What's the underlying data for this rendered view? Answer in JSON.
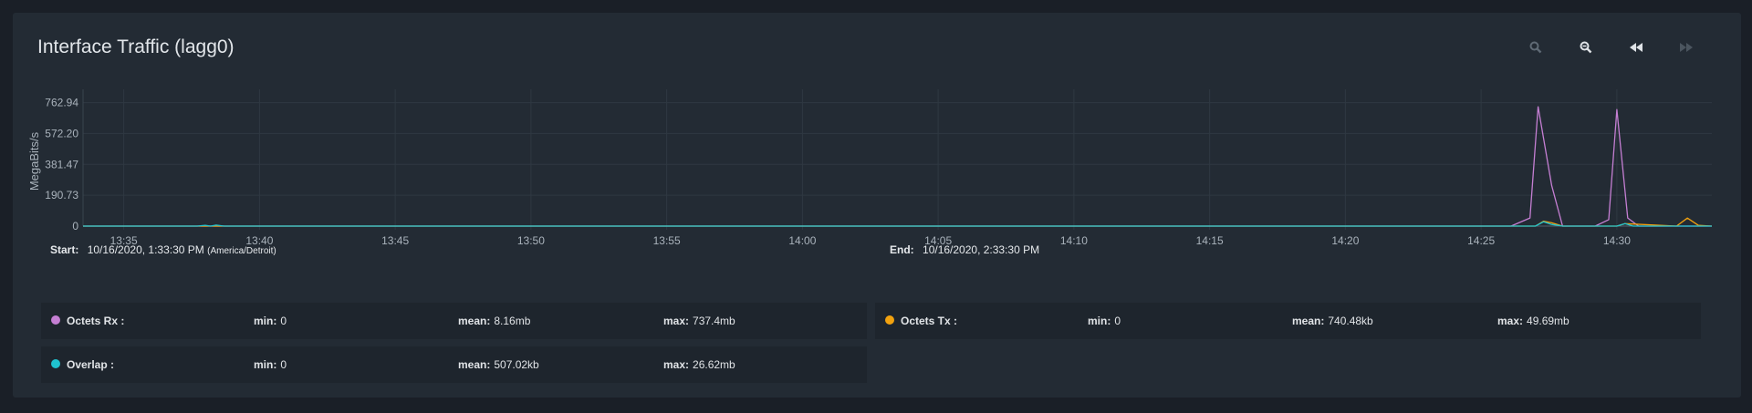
{
  "title": "Interface Traffic (lagg0)",
  "toolbar": {
    "zoom_in_icon": "zoom-in-icon",
    "zoom_out_icon": "zoom-out-icon",
    "step_back_icon": "rewind-icon",
    "step_forward_icon": "fast-forward-icon"
  },
  "range": {
    "start_label": "Start:",
    "start_value": "10/16/2020, 1:33:30 PM",
    "start_tz": "(America/Detroit)",
    "end_label": "End:",
    "end_value": "10/16/2020, 2:33:30 PM"
  },
  "legend": [
    {
      "name": "Octets Rx :",
      "color": "#c57fd3",
      "min_label": "min:",
      "min": "0",
      "mean_label": "mean:",
      "mean": "8.16mb",
      "max_label": "max:",
      "max": "737.4mb"
    },
    {
      "name": "Octets Tx :",
      "color": "#f2a20f",
      "min_label": "min:",
      "min": "0",
      "mean_label": "mean:",
      "mean": "740.48kb",
      "max_label": "max:",
      "max": "49.69mb"
    },
    {
      "name": "Overlap :",
      "color": "#1fc3cf",
      "min_label": "min:",
      "min": "0",
      "mean_label": "mean:",
      "mean": "507.02kb",
      "max_label": "max:",
      "max": "26.62mb"
    }
  ],
  "chart_data": {
    "type": "line",
    "ylabel": "MegaBits/s",
    "y_ticks": [
      "762.94",
      "572.20",
      "381.47",
      "190.73",
      "0"
    ],
    "y_tick_values": [
      762.94,
      572.2,
      381.47,
      190.73,
      0
    ],
    "ylim": [
      0,
      800
    ],
    "x_ticks": [
      "13:35",
      "13:40",
      "13:45",
      "13:50",
      "13:55",
      "14:00",
      "14:05",
      "14:10",
      "14:15",
      "14:20",
      "14:25",
      "14:30"
    ],
    "x_tick_minutes": [
      815,
      820,
      825,
      830,
      835,
      840,
      845,
      850,
      855,
      860,
      865,
      870
    ],
    "xlim_minutes": [
      813.5,
      873.5
    ],
    "grid": true,
    "colors": {
      "rx": "#c57fd3",
      "tx": "#f2a20f",
      "overlap": "#1fc3cf"
    },
    "series": [
      {
        "name": "Octets Rx",
        "x": [
          813.5,
          837,
          866.1,
          866.8,
          867.1,
          867.6,
          868.0,
          869.2,
          869.7,
          870.0,
          870.4,
          870.8,
          873.5
        ],
        "values": [
          0,
          0,
          0,
          50,
          737.4,
          250,
          0,
          0,
          40,
          720,
          50,
          0,
          0
        ]
      },
      {
        "name": "Octets Tx",
        "x": [
          813.5,
          867.0,
          867.3,
          867.6,
          868.0,
          870.0,
          870.3,
          872.2,
          872.6,
          873.0,
          873.5
        ],
        "values": [
          0,
          0,
          30,
          20,
          0,
          0,
          15,
          0,
          49.69,
          5,
          0
        ]
      },
      {
        "name": "Overlap",
        "x": [
          813.5,
          817.7,
          818.0,
          818.2,
          818.4,
          818.7,
          867.0,
          867.3,
          867.6,
          868.0,
          870.0,
          870.3,
          870.6,
          873.5
        ],
        "values": [
          0,
          0,
          5,
          0,
          6,
          0,
          0,
          26.62,
          10,
          0,
          0,
          15,
          0,
          0
        ]
      }
    ]
  }
}
